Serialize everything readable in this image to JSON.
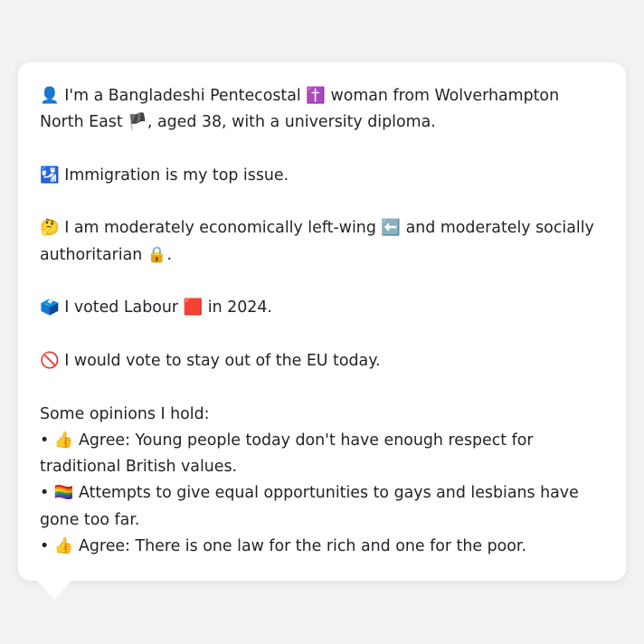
{
  "bio": {
    "intro_emoji": "👤",
    "intro_text_1": "I'm a Bangladeshi Pentecostal",
    "religion_emoji": "✝️",
    "intro_text_2": "woman from Wolverhampton North East",
    "flag_emoji": "🏴",
    "intro_text_3": ", aged 38, with a university diploma."
  },
  "issue": {
    "emoji": "🛂",
    "text": "Immigration is my top issue."
  },
  "ideology": {
    "emoji": "🤔",
    "text_1": "I am moderately economically left-wing",
    "left_emoji": "⬅️",
    "text_2": "and moderately socially authoritarian",
    "lock_emoji": "🔒",
    "text_3": "."
  },
  "vote": {
    "emoji": "🗳️",
    "text_1": "I voted Labour",
    "party_emoji": "🟥",
    "text_2": "in 2024."
  },
  "eu": {
    "emoji": "🚫",
    "text": "I would vote to stay out of the EU today."
  },
  "opinions": {
    "heading": "Some opinions I hold:",
    "items": [
      {
        "bullet": "•",
        "emoji": "👍",
        "text": "Agree: Young people today don't have enough respect for traditional British values."
      },
      {
        "bullet": "•",
        "emoji": "🏳️‍🌈",
        "text": "Attempts to give equal opportunities to gays and lesbians have gone too far."
      },
      {
        "bullet": "•",
        "emoji": "👍",
        "text": "Agree: There is one law for the rich and one for the poor."
      }
    ]
  }
}
